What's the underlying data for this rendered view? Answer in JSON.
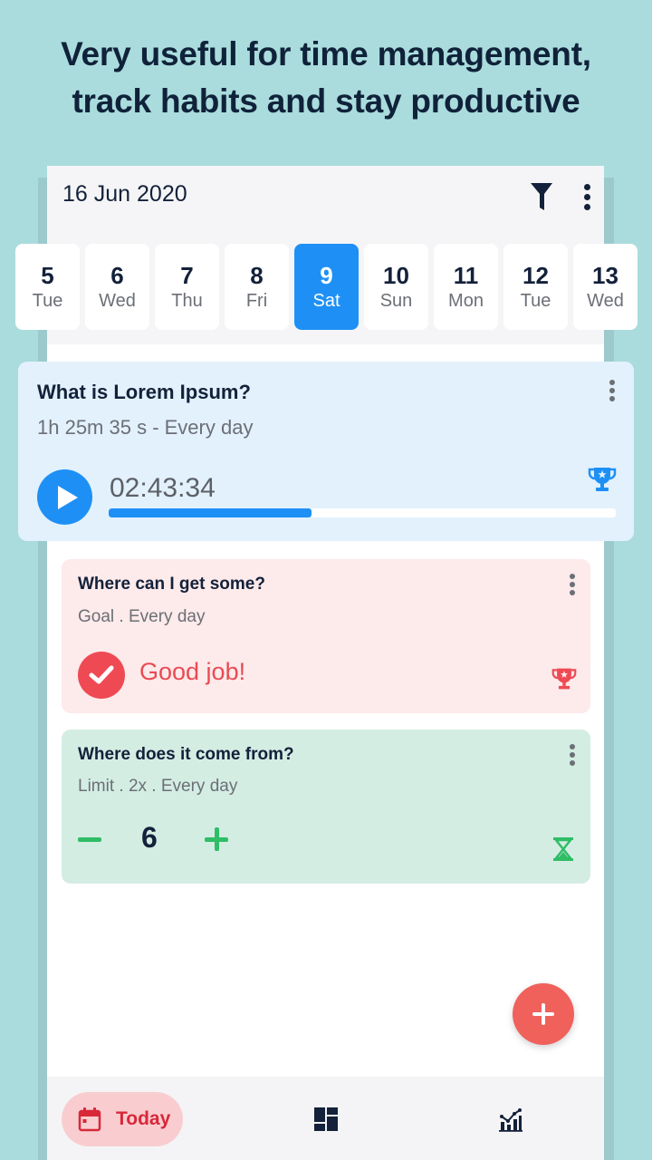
{
  "promo": {
    "headline_line1": "Very useful for time management,",
    "headline_line2": "track habits and stay productive"
  },
  "header": {
    "date": "16 Jun 2020",
    "filter_icon": "filter-icon",
    "more_icon": "more-vertical-icon"
  },
  "date_strip": {
    "days": [
      {
        "num": "5",
        "dow": "Tue",
        "selected": false
      },
      {
        "num": "6",
        "dow": "Wed",
        "selected": false
      },
      {
        "num": "7",
        "dow": "Thu",
        "selected": false
      },
      {
        "num": "8",
        "dow": "Fri",
        "selected": false
      },
      {
        "num": "9",
        "dow": "Sat",
        "selected": true
      },
      {
        "num": "10",
        "dow": "Sun",
        "selected": false
      },
      {
        "num": "11",
        "dow": "Mon",
        "selected": false
      },
      {
        "num": "12",
        "dow": "Tue",
        "selected": false
      },
      {
        "num": "13",
        "dow": "Wed",
        "selected": false
      }
    ]
  },
  "habits": {
    "timer": {
      "title": "What is Lorem Ipsum?",
      "subtitle": "1h 25m 35 s - Every day",
      "elapsed": "02:43:34",
      "progress_percent": 40,
      "play_icon": "play-icon",
      "trophy_icon": "trophy-icon",
      "color": "#1e90f5",
      "background": "#e3f1fd"
    },
    "goal": {
      "title": "Where can I get some?",
      "subtitle": "Goal . Every day",
      "status": "Good job!",
      "check_icon": "check-circle-icon",
      "trophy_icon": "trophy-icon",
      "color": "#ef4a54",
      "background": "#fdeaea"
    },
    "limit": {
      "title": "Where does it come from?",
      "subtitle": "Limit . 2x . Every day",
      "count": "6",
      "hourglass_icon": "hourglass-icon",
      "color": "#2fbd66",
      "background": "#d4ede3"
    }
  },
  "fab": {
    "icon": "plus-icon",
    "color": "#f0615c"
  },
  "bottom_nav": {
    "today_label": "Today",
    "today_icon": "calendar-icon",
    "dashboard_icon": "dashboard-icon",
    "stats_icon": "stats-chart-icon",
    "active_color": "#d8283a"
  },
  "colors": {
    "page_background": "#aadcdd",
    "accent_blue": "#1e90f5",
    "text_dark": "#13213a"
  }
}
